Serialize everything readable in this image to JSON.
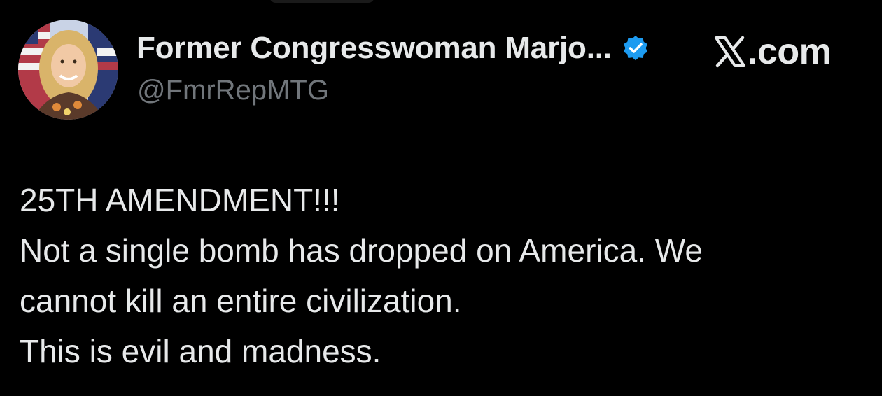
{
  "tweet": {
    "author": {
      "display_name": "Former Congresswoman Marjo...",
      "handle": "@FmrRepMTG",
      "verified": true,
      "avatar_icon": "profile-photo"
    },
    "brand": {
      "icon": "x-logo-icon",
      "text": ".com"
    },
    "lines": [
      "25TH AMENDMENT!!!",
      "Not a single bomb has dropped on America. We",
      "cannot kill an entire civilization.",
      "This is evil and madness."
    ]
  },
  "colors": {
    "background": "#000000",
    "primary_text": "#e7e9ea",
    "secondary_text": "#71767b",
    "verified_badge": "#1d9bf0"
  }
}
